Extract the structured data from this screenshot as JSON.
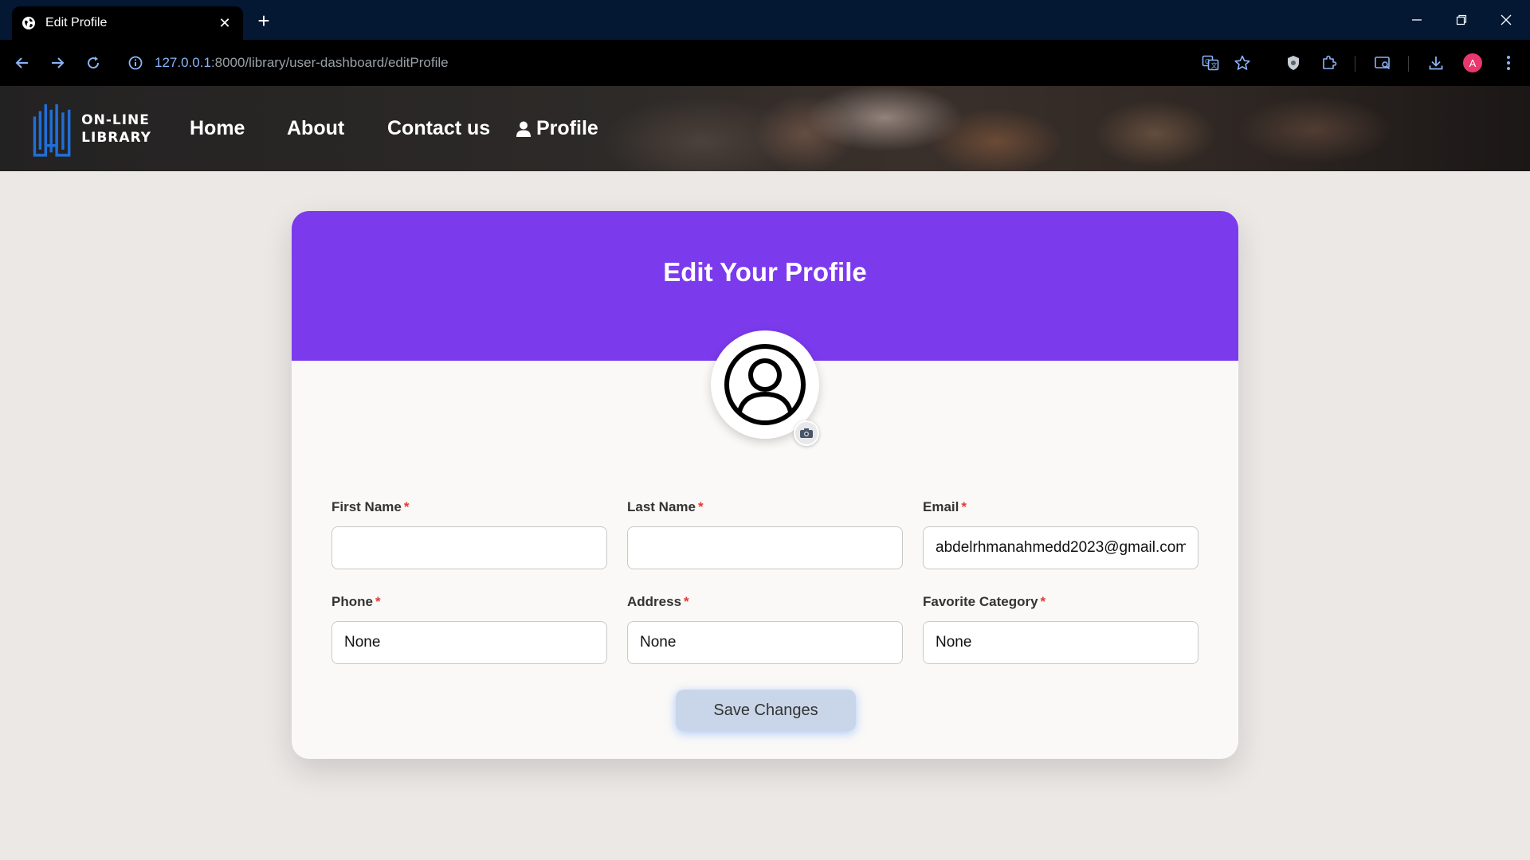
{
  "browser": {
    "tab_title": "Edit Profile",
    "url_host": "127.0.0.1",
    "url_path": ":8000/library/user-dashboard/editProfile",
    "profile_initial": "A"
  },
  "site": {
    "logo_line1": "ON-LINE",
    "logo_line2": "LIBRARY",
    "nav": {
      "home": "Home",
      "about": "About",
      "contact": "Contact us",
      "profile": "Profile"
    }
  },
  "form": {
    "title": "Edit Your Profile",
    "required_marker": "*",
    "fields": {
      "first_name": {
        "label": "First Name",
        "value": ""
      },
      "last_name": {
        "label": "Last Name",
        "value": ""
      },
      "email": {
        "label": "Email",
        "value": "abdelrhmanahmedd2023@gmail.com"
      },
      "phone": {
        "label": "Phone",
        "value": "None"
      },
      "address": {
        "label": "Address",
        "value": "None"
      },
      "favorite_category": {
        "label": "Favorite Category",
        "value": "None"
      }
    },
    "save_label": "Save Changes"
  },
  "colors": {
    "accent": "#7c3aed",
    "required": "#e53935",
    "tab_bar": "#041733",
    "save_button": "#c9d6ea"
  },
  "icons": {
    "avatar": "user-circle-icon",
    "photo": "camera-icon",
    "profile_nav": "person-icon"
  }
}
